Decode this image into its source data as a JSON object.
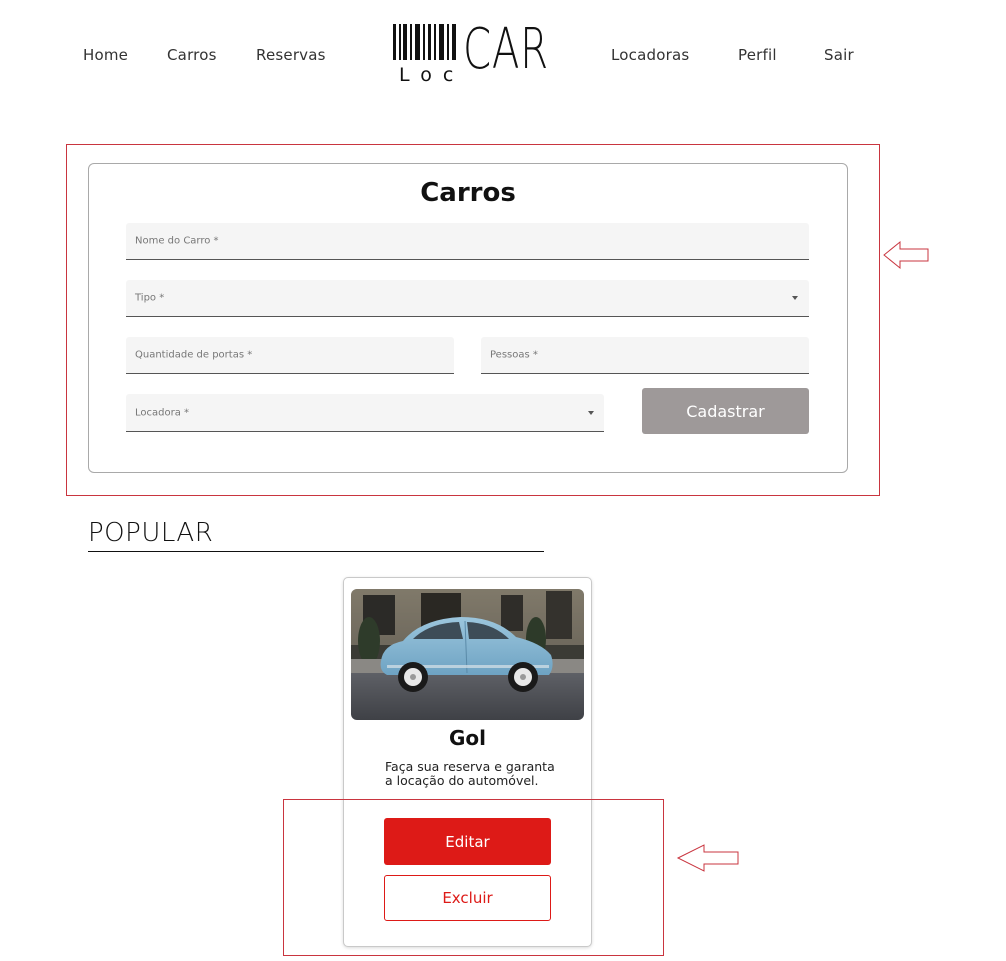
{
  "nav": {
    "left_items": [
      {
        "label": "Home"
      },
      {
        "label": "Carros"
      },
      {
        "label": "Reservas"
      }
    ],
    "right_items": [
      {
        "label": "Locadoras"
      },
      {
        "label": "Perfil"
      },
      {
        "label": "Sair"
      }
    ]
  },
  "logo": {
    "small_text": "Loc",
    "big_text": "CAR"
  },
  "form": {
    "title": "Carros",
    "fields": {
      "nome": {
        "label": "Nome do Carro *",
        "value": ""
      },
      "tipo": {
        "label": "Tipo *",
        "value": ""
      },
      "portas": {
        "label": "Quantidade de portas *",
        "value": ""
      },
      "pessoas": {
        "label": "Pessoas *",
        "value": ""
      },
      "locadora": {
        "label": "Locadora *",
        "value": ""
      }
    },
    "submit_label": "Cadastrar"
  },
  "popular": {
    "title": "POPULAR",
    "cards": [
      {
        "name": "Gol",
        "description": "Faça sua reserva e garanta a locação do automóvel.",
        "edit_label": "Editar",
        "delete_label": "Excluir"
      }
    ]
  },
  "colors": {
    "accent_red": "#dd1a17",
    "button_gray": "#9e9999",
    "annotation_red": "#c9353f",
    "field_bg": "#f5f5f5"
  },
  "icons": [
    "barcode-icon",
    "dropdown-caret-icon",
    "left-arrow-annotation-icon"
  ]
}
